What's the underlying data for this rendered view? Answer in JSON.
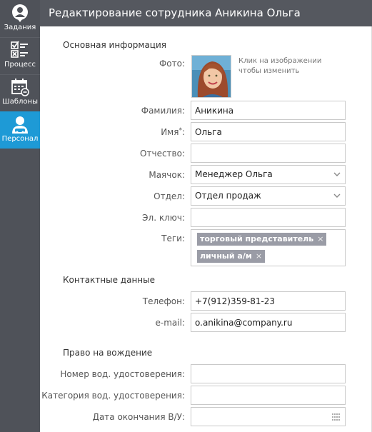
{
  "sidebar": {
    "items": [
      {
        "label": "Задания",
        "icon": "tasks-icon",
        "active": false
      },
      {
        "label": "Процесс",
        "icon": "process-checklist-icon",
        "active": false
      },
      {
        "label": "Шаблоны",
        "icon": "templates-calendar-icon",
        "active": false
      },
      {
        "label": "Персонал",
        "icon": "personnel-icon",
        "active": true
      }
    ]
  },
  "header": {
    "title": "Редактирование сотрудника Аникина Ольга"
  },
  "basic": {
    "section_title": "Основная информация",
    "photo_label": "Фото:",
    "photo_hint": "Клик на изображении чтобы изменить",
    "lastname_label": "Фамилия:",
    "lastname_value": "Аникина",
    "firstname_label": "Имя",
    "required_mark": "*",
    "label_colon": ":",
    "firstname_value": "Ольга",
    "middlename_label": "Отчество:",
    "middlename_value": "",
    "beacon_label": "Маячок:",
    "beacon_value": "Менеджер Ольга",
    "department_label": "Отдел:",
    "department_value": "Отдел продаж",
    "ekey_label": "Эл. ключ:",
    "ekey_value": "",
    "tags_label": "Теги:",
    "tags": [
      "торговый представитель",
      "личный а/м"
    ],
    "tag_remove": "×"
  },
  "contacts": {
    "section_title": "Контактные данные",
    "phone_label": "Телефон:",
    "phone_value": "+7(912)359-81-23",
    "email_label": "e-mail:",
    "email_value": "o.anikina@company.ru"
  },
  "driving": {
    "section_title": "Право на вождение",
    "license_number_label": "Номер вод. удостоверения:",
    "license_number_value": "",
    "license_category_label": "Категория вод. удостоверения:",
    "license_category_value": "",
    "license_expiry_label": "Дата окончания В/У:",
    "license_expiry_value": ""
  },
  "colors": {
    "sidebar": "#4f5259",
    "header": "#55585f",
    "active": "#1e9ad6",
    "tag": "#9a9ca6"
  }
}
